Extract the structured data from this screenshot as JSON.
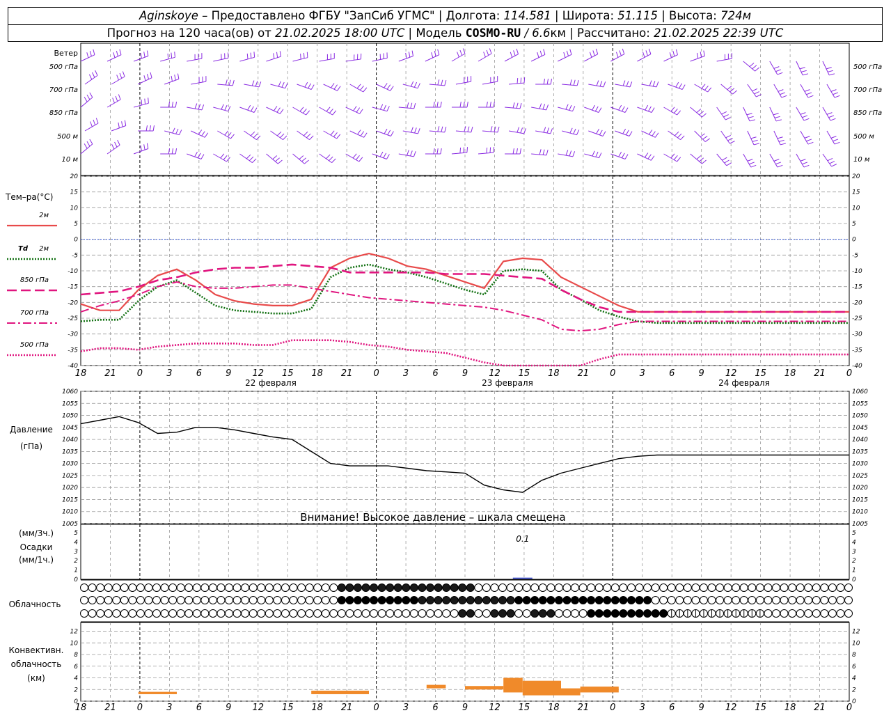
{
  "header": {
    "station": "Aginskoye",
    "provider": " – Предоставлено ФГБУ \"ЗапСиб УГМС\" | Долгота: ",
    "lon": "114.581",
    "lat_label": " | Широта: ",
    "lat": "51.115",
    "alt_label": " | Высота: ",
    "alt": "724м",
    "forecast_prefix": "Прогноз на 120 часа(ов) от ",
    "forecast_time": "21.02.2025 18:00 UTC",
    "model_label": " | Модель ",
    "model": "COSMO-RU",
    "model_res": " / 6.6",
    "model_unit": "км | Рассчитано: ",
    "calc_time": "21.02.2025 22:39 UTC"
  },
  "x_ticks": [
    "18",
    "21",
    "0",
    "3",
    "6",
    "9",
    "12",
    "15",
    "18",
    "21",
    "0",
    "3",
    "6",
    "9",
    "12",
    "15",
    "18",
    "21",
    "0",
    "3",
    "6",
    "9",
    "12",
    "15",
    "18",
    "21",
    "0"
  ],
  "day_labels": [
    "22 февраля",
    "23 февраля",
    "24 февраля"
  ],
  "wind_panel": {
    "title": "Ветер",
    "levels": [
      "500 гПа",
      "700 гПа",
      "850 гПа",
      "500 м",
      "10 м"
    ],
    "color": "#8a2be2"
  },
  "temp_panel": {
    "title": "Тем–ра(°С)",
    "legend": [
      {
        "label": "2м",
        "color": "#e84a4a",
        "style": "solid"
      },
      {
        "label_prefix": "Td",
        "label": "2м",
        "color": "#117011",
        "style": "dotted"
      },
      {
        "label": "850 гПа",
        "color": "#e0157f",
        "style": "dash"
      },
      {
        "label": "700 гПа",
        "color": "#e0157f",
        "style": "dashdot"
      },
      {
        "label": "500 гПа",
        "color": "#e0157f",
        "style": "dot"
      }
    ],
    "y_ticks": [
      20,
      15,
      10,
      5,
      0,
      -5,
      -10,
      -15,
      -20,
      -25,
      -30,
      -35,
      -40
    ]
  },
  "pressure_panel": {
    "title": "Давление",
    "unit": "(гПа)",
    "y_ticks": [
      1060,
      1055,
      1050,
      1045,
      1040,
      1035,
      1030,
      1025,
      1020,
      1015,
      1010,
      1005
    ],
    "warning": "Внимание! Высокое давление – шкала смещена"
  },
  "precip_panel": {
    "label1": "(мм/3ч.)",
    "label2": "Осадки",
    "label3": "(мм/1ч.)",
    "y_ticks": [
      5,
      4,
      3,
      2,
      1,
      0
    ],
    "annotation": "0.1"
  },
  "cloud_panel": {
    "title": "Облачность"
  },
  "conv_panel": {
    "title1": "Конвективн.",
    "title2": "облачность",
    "title3": "(км)",
    "y_ticks": [
      12,
      10,
      8,
      6,
      4,
      2,
      0
    ],
    "color": "#f08a2a"
  },
  "chart_data": [
    {
      "type": "line",
      "title": "Тем–ра(°С)",
      "x_hours": [
        0,
        3,
        6,
        9,
        12,
        15,
        18,
        21,
        24,
        27,
        30,
        33,
        36,
        39,
        42,
        45,
        48,
        51,
        54,
        57,
        60,
        63,
        66,
        69,
        72,
        75,
        78,
        81,
        84,
        87,
        90,
        93,
        96,
        99,
        102,
        105,
        108,
        111,
        114,
        117,
        120
      ],
      "ylim": [
        -40,
        20
      ],
      "series": [
        {
          "name": "2м",
          "values": [
            -20.5,
            -22.5,
            -22.5,
            -16,
            -11.5,
            -9.5,
            -13,
            -17.5,
            -19.5,
            -20.5,
            -21,
            -21,
            -19,
            -9,
            -6,
            -4.5,
            -6,
            -8.5,
            -9.5,
            -11.5,
            -13.5,
            -15.5,
            -7,
            -6,
            -6.5,
            -12,
            -15,
            -18,
            -21,
            -23,
            -23,
            -23,
            -23,
            -23,
            -23,
            -23,
            -23,
            -23,
            -23,
            -23,
            -23
          ]
        },
        {
          "name": "Td 2м",
          "values": [
            -26,
            -25.5,
            -25.5,
            -19.5,
            -15,
            -13,
            -17,
            -21,
            -22.5,
            -23,
            -23.5,
            -23.5,
            -22,
            -12,
            -9,
            -8,
            -9.5,
            -10.5,
            -12,
            -14,
            -16,
            -17.5,
            -10,
            -9.5,
            -10,
            -16,
            -19,
            -22.5,
            -24.5,
            -26,
            -26.5,
            -26.5,
            -26.5,
            -26.5,
            -26.5,
            -26.5,
            -26.5,
            -26.5,
            -26.5,
            -26.5,
            -26.5
          ]
        },
        {
          "name": "850 гПа",
          "values": [
            -17.5,
            -17,
            -16.5,
            -15,
            -13,
            -12,
            -10.5,
            -9.5,
            -9,
            -9,
            -8.5,
            -8,
            -8.5,
            -9,
            -10.5,
            -10.5,
            -10.5,
            -10.5,
            -10.5,
            -11,
            -11,
            -11,
            -11.5,
            -12,
            -12.5,
            -16,
            -19,
            -21.5,
            -23,
            -23,
            -23,
            -23,
            -23,
            -23,
            -23,
            -23,
            -23,
            -23,
            -23,
            -23,
            -23
          ]
        },
        {
          "name": "700 гПа",
          "values": [
            -23,
            -21,
            -19.5,
            -17.5,
            -15,
            -13.5,
            -15,
            -15.5,
            -15.5,
            -15,
            -14.5,
            -14.5,
            -15.5,
            -16.5,
            -17.5,
            -18.5,
            -19,
            -19.5,
            -20,
            -20.5,
            -21,
            -21.5,
            -22.5,
            -24,
            -25.5,
            -28.5,
            -29,
            -28.5,
            -27,
            -26,
            -26,
            -26,
            -26,
            -26,
            -26,
            -26,
            -26,
            -26,
            -26,
            -26,
            -26
          ]
        },
        {
          "name": "500 гПа",
          "values": [
            -35.5,
            -34.5,
            -34.5,
            -35,
            -34,
            -33.5,
            -33,
            -33,
            -33,
            -33.5,
            -33.5,
            -32,
            -32,
            -32,
            -32.5,
            -33.5,
            -34,
            -35,
            -35.5,
            -36,
            -37.5,
            -39,
            -40,
            -41.5,
            -42.5,
            -41,
            -40,
            -38,
            -36.5,
            -36.5,
            -36.5,
            -36.5,
            -36.5,
            -36.5,
            -36.5,
            -36.5,
            -36.5,
            -36.5,
            -36.5,
            -36.5,
            -36.5
          ]
        }
      ]
    },
    {
      "type": "line",
      "title": "Давление",
      "x_hours": [
        0,
        3,
        6,
        9,
        12,
        15,
        18,
        21,
        24,
        27,
        30,
        33,
        36,
        39,
        42,
        45,
        48,
        51,
        54,
        57,
        60,
        63,
        66,
        69,
        72,
        75,
        78,
        81,
        84,
        87,
        90,
        93,
        96,
        99,
        102,
        105,
        108,
        111,
        114,
        117,
        120
      ],
      "ylim": [
        1005,
        1060
      ],
      "series": [
        {
          "name": "Давление",
          "values": [
            1046.5,
            1048,
            1049.5,
            1047,
            1042.5,
            1043,
            1045,
            1045,
            1044,
            1042.5,
            1041,
            1040,
            1035,
            1030,
            1029,
            1029,
            1029,
            1028,
            1027,
            1026.5,
            1026,
            1021,
            1019,
            1018,
            1023,
            1026,
            1028,
            1030,
            1032,
            1033,
            1033.5,
            1033.5,
            1033.5,
            1033.5,
            1033.5,
            1033.5,
            1033.5,
            1033.5,
            1033.5,
            1033.5,
            1033.5
          ]
        }
      ]
    },
    {
      "type": "bar",
      "title": "Осадки",
      "x_hours": [
        69
      ],
      "values": [
        0.1
      ],
      "ylim": [
        0,
        5
      ]
    },
    {
      "type": "bar",
      "title": "Конвективн. облачность",
      "ylim": [
        0,
        13
      ],
      "layers": [
        {
          "x_start": 9,
          "x_end": 15,
          "bottom": 1.2,
          "top": 1.6
        },
        {
          "x_start": 36,
          "x_end": 45,
          "bottom": 1.2,
          "top": 1.8
        },
        {
          "x_start": 54,
          "x_end": 57,
          "bottom": 2.2,
          "top": 2.8
        },
        {
          "x_start": 60,
          "x_end": 66,
          "bottom": 2.0,
          "top": 2.6
        },
        {
          "x_start": 66,
          "x_end": 69,
          "bottom": 1.5,
          "top": 4.0
        },
        {
          "x_start": 69,
          "x_end": 75,
          "bottom": 1.0,
          "top": 3.5
        },
        {
          "x_start": 75,
          "x_end": 78,
          "bottom": 1.0,
          "top": 2.2
        },
        {
          "x_start": 78,
          "x_end": 84,
          "bottom": 1.5,
          "top": 2.5
        }
      ]
    }
  ]
}
